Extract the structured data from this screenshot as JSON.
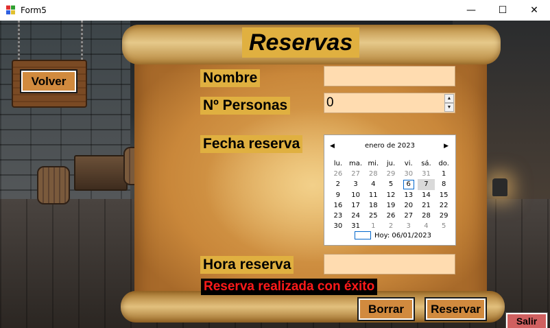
{
  "window": {
    "title": "Form5",
    "minimize_glyph": "—",
    "maximize_glyph": "☐",
    "close_glyph": "✕"
  },
  "form": {
    "heading": "Reservas",
    "nombre_label": "Nombre",
    "nombre_value": "",
    "personas_label": "Nº Personas",
    "personas_value": "0",
    "fecha_label": "Fecha reserva",
    "hora_label": "Hora reserva",
    "hora_value": "",
    "status_message": "Reserva realizada con éxito"
  },
  "calendar": {
    "month_label": "enero de 2023",
    "prev_glyph": "◀",
    "next_glyph": "▶",
    "weekdays": [
      "lu.",
      "ma.",
      "mi.",
      "ju.",
      "vi.",
      "sá.",
      "do."
    ],
    "weeks": [
      [
        {
          "d": "26",
          "dim": true
        },
        {
          "d": "27",
          "dim": true
        },
        {
          "d": "28",
          "dim": true
        },
        {
          "d": "29",
          "dim": true
        },
        {
          "d": "30",
          "dim": true
        },
        {
          "d": "31",
          "dim": true
        },
        {
          "d": "1"
        }
      ],
      [
        {
          "d": "2"
        },
        {
          "d": "3"
        },
        {
          "d": "4"
        },
        {
          "d": "5"
        },
        {
          "d": "6",
          "today": true
        },
        {
          "d": "7",
          "selected": true
        },
        {
          "d": "8"
        }
      ],
      [
        {
          "d": "9"
        },
        {
          "d": "10"
        },
        {
          "d": "11"
        },
        {
          "d": "12"
        },
        {
          "d": "13"
        },
        {
          "d": "14"
        },
        {
          "d": "15"
        }
      ],
      [
        {
          "d": "16"
        },
        {
          "d": "17"
        },
        {
          "d": "18"
        },
        {
          "d": "19"
        },
        {
          "d": "20"
        },
        {
          "d": "21"
        },
        {
          "d": "22"
        }
      ],
      [
        {
          "d": "23"
        },
        {
          "d": "24"
        },
        {
          "d": "25"
        },
        {
          "d": "26"
        },
        {
          "d": "27"
        },
        {
          "d": "28"
        },
        {
          "d": "29"
        }
      ],
      [
        {
          "d": "30"
        },
        {
          "d": "31"
        },
        {
          "d": "1",
          "dim": true
        },
        {
          "d": "2",
          "dim": true
        },
        {
          "d": "3",
          "dim": true
        },
        {
          "d": "4",
          "dim": true
        },
        {
          "d": "5",
          "dim": true
        }
      ]
    ],
    "today_label": "Hoy: 06/01/2023"
  },
  "buttons": {
    "volver": "Volver",
    "borrar": "Borrar",
    "reservar": "Reservar",
    "salir": "Salir"
  },
  "colors": {
    "label_bg": "#e0b040",
    "input_bg": "#ffdcb0",
    "button_bg": "#d18a3e",
    "salir_bg": "#d06060",
    "status_text": "#ff1a1a"
  }
}
